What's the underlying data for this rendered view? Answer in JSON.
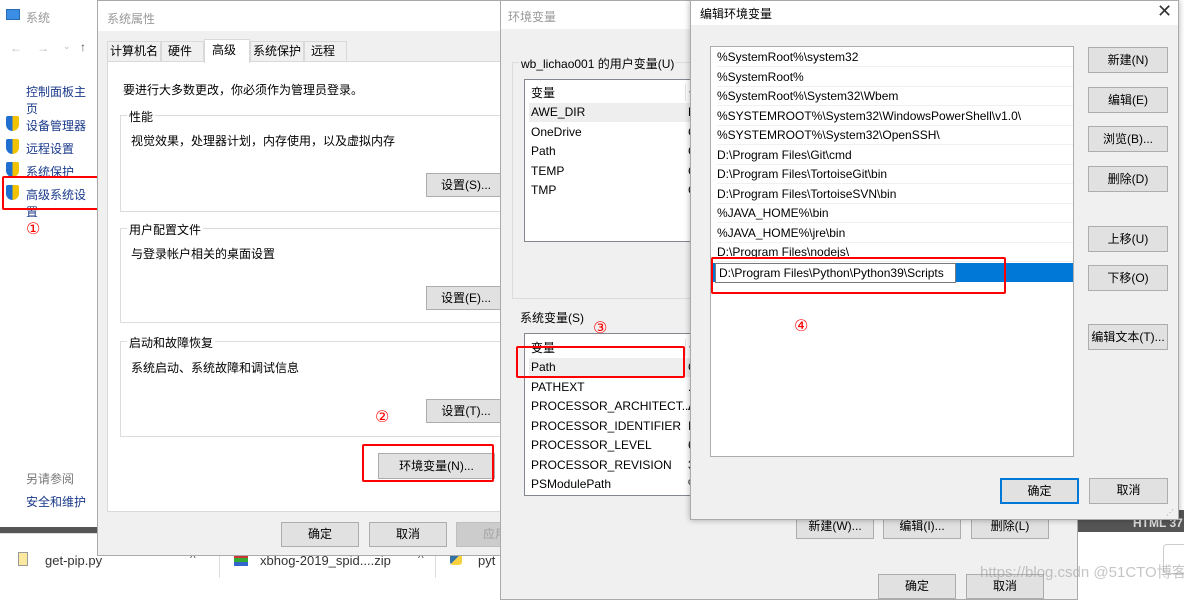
{
  "system_window": {
    "title": "系统",
    "control_panel_home": "控制面板主页",
    "items": [
      "设备管理器",
      "远程设置",
      "系统保护",
      "高级系统设置"
    ],
    "see_also": "另请参阅",
    "security": "安全和维护"
  },
  "sysprops": {
    "title": "系统属性",
    "tabs": [
      "计算机名",
      "硬件",
      "高级",
      "系统保护",
      "远程"
    ],
    "active_tab": "高级",
    "admin_note": "要进行大多数更改，你必须作为管理员登录。",
    "groups": [
      {
        "label": "性能",
        "desc": "视觉效果，处理器计划，内存使用，以及虚拟内存",
        "button": "设置(S)..."
      },
      {
        "label": "用户配置文件",
        "desc": "与登录帐户相关的桌面设置",
        "button": "设置(E)..."
      },
      {
        "label": "启动和故障恢复",
        "desc": "系统启动、系统故障和调试信息",
        "button": "设置(T)..."
      }
    ],
    "env_button": "环境变量(N)...",
    "ok": "确定",
    "cancel": "取消",
    "apply": "应用"
  },
  "envvars": {
    "title": "环境变量",
    "user_group": "wb_lichao001 的用户变量(U)",
    "col_var": "变量",
    "col_val": "值",
    "user_vars": [
      "AWE_DIR",
      "OneDrive",
      "Path",
      "TEMP",
      "TMP"
    ],
    "user_vals": [
      "D",
      "C",
      "C",
      "C",
      "C"
    ],
    "sys_group": "系统变量(S)",
    "sys_vars": [
      "Path",
      "PATHEXT",
      "PROCESSOR_ARCHITECT...",
      "PROCESSOR_IDENTIFIER",
      "PROCESSOR_LEVEL",
      "PROCESSOR_REVISION",
      "PSModulePath"
    ],
    "sys_vals": [
      "C",
      ".",
      "A",
      "I",
      "6",
      "3",
      "%"
    ],
    "new": "新建(W)...",
    "edit": "编辑(I)...",
    "delete": "删除(L)",
    "ok": "确定",
    "cancel": "取消"
  },
  "editenv": {
    "title": "编辑环境变量",
    "entries": [
      "%SystemRoot%\\system32",
      "%SystemRoot%",
      "%SystemRoot%\\System32\\Wbem",
      "%SYSTEMROOT%\\System32\\WindowsPowerShell\\v1.0\\",
      "%SYSTEMROOT%\\System32\\OpenSSH\\",
      "D:\\Program Files\\Git\\cmd",
      "D:\\Program Files\\TortoiseGit\\bin",
      "D:\\Program Files\\TortoiseSVN\\bin",
      "%JAVA_HOME%\\bin",
      "%JAVA_HOME%\\jre\\bin",
      "D:\\Program Files\\nodejs\\"
    ],
    "editing_value": "D:\\Program Files\\Python\\Python39\\Scripts",
    "buttons": [
      "新建(N)",
      "编辑(E)",
      "浏览(B)...",
      "删除(D)",
      "上移(U)",
      "下移(O)",
      "编辑文本(T)..."
    ],
    "ok": "确定",
    "cancel": "取消",
    "close_icon": "close-icon"
  },
  "annotations": [
    "①",
    "②",
    "③",
    "④"
  ],
  "downloads": [
    "get-pip.py",
    "xbhog-2019_spid....zip",
    "pyt"
  ],
  "background_label": "HTML 37",
  "watermark": "https://blog.csdn @51CTO博客",
  "colors": {
    "selection": "#0078d7",
    "annotation": "#ff0000",
    "dialog_bg": "#f0f0f0"
  }
}
